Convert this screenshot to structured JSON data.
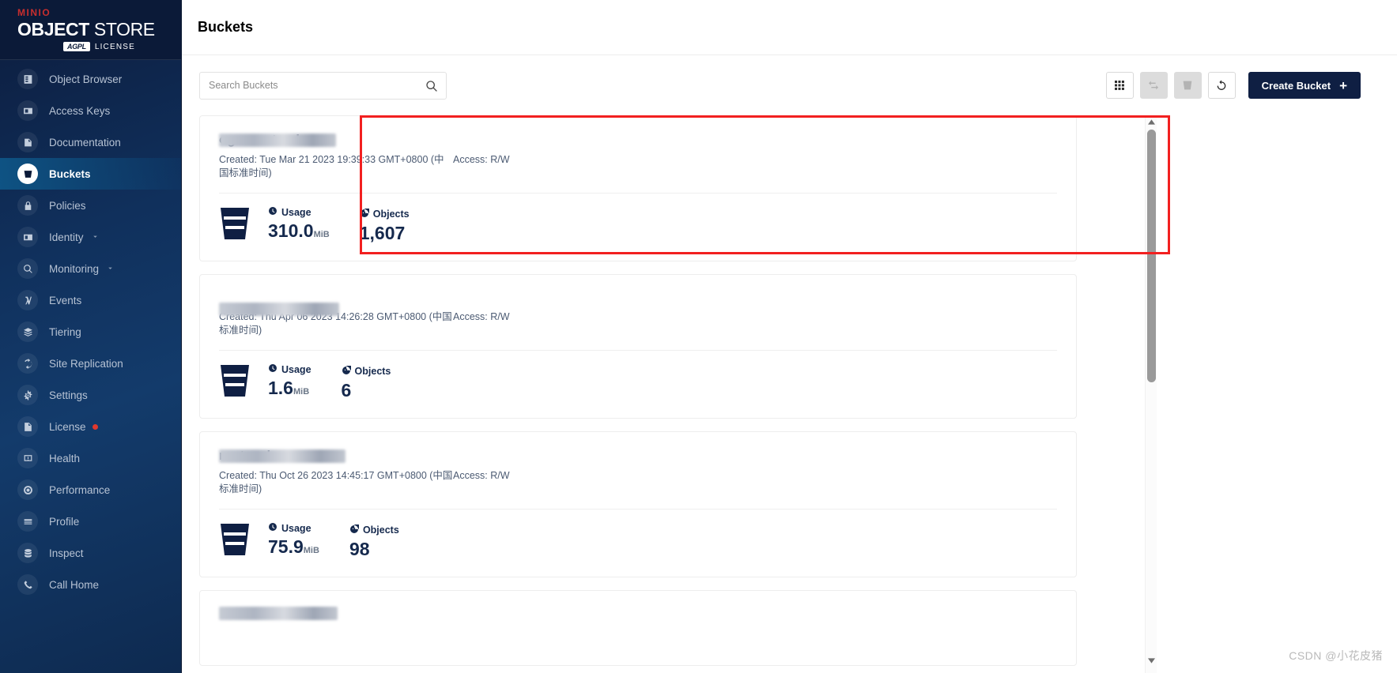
{
  "brand": {
    "minio": "MINIO",
    "object": "OBJECT",
    "store": "STORE",
    "badge": "AGPL",
    "license": "LICENSE"
  },
  "sidebar": {
    "items": [
      {
        "label": "Object Browser",
        "icon": "object-browser-icon",
        "active": false,
        "chevron": false,
        "dot": false
      },
      {
        "label": "Access Keys",
        "icon": "access-keys-icon",
        "active": false,
        "chevron": false,
        "dot": false
      },
      {
        "label": "Documentation",
        "icon": "documentation-icon",
        "active": false,
        "chevron": false,
        "dot": false
      },
      {
        "label": "Buckets",
        "icon": "bucket-icon",
        "active": true,
        "chevron": false,
        "dot": false
      },
      {
        "label": "Policies",
        "icon": "lock-icon",
        "active": false,
        "chevron": false,
        "dot": false
      },
      {
        "label": "Identity",
        "icon": "identity-card-icon",
        "active": false,
        "chevron": true,
        "dot": false
      },
      {
        "label": "Monitoring",
        "icon": "magnifier-icon",
        "active": false,
        "chevron": true,
        "dot": false
      },
      {
        "label": "Events",
        "icon": "lambda-icon",
        "active": false,
        "chevron": false,
        "dot": false
      },
      {
        "label": "Tiering",
        "icon": "layers-icon",
        "active": false,
        "chevron": false,
        "dot": false
      },
      {
        "label": "Site Replication",
        "icon": "replication-icon",
        "active": false,
        "chevron": false,
        "dot": false
      },
      {
        "label": "Settings",
        "icon": "gear-icon",
        "active": false,
        "chevron": false,
        "dot": false
      },
      {
        "label": "License",
        "icon": "license-icon",
        "active": false,
        "chevron": false,
        "dot": true
      },
      {
        "label": "Health",
        "icon": "health-icon",
        "active": false,
        "chevron": false,
        "dot": false
      },
      {
        "label": "Performance",
        "icon": "performance-icon",
        "active": false,
        "chevron": false,
        "dot": false
      },
      {
        "label": "Profile",
        "icon": "profile-icon",
        "active": false,
        "chevron": false,
        "dot": false
      },
      {
        "label": "Inspect",
        "icon": "inspect-icon",
        "active": false,
        "chevron": false,
        "dot": false
      },
      {
        "label": "Call Home",
        "icon": "phone-icon",
        "active": false,
        "chevron": false,
        "dot": false
      }
    ]
  },
  "header": {
    "title": "Buckets"
  },
  "toolbar": {
    "search_placeholder": "Search Buckets",
    "search_value": "",
    "buttons": [
      {
        "name": "grid-view-button",
        "icon": "grid-icon",
        "disabled": false
      },
      {
        "name": "replication-button",
        "icon": "replication-icon",
        "disabled": true
      },
      {
        "name": "delete-bucket-button",
        "icon": "trash-bucket-icon",
        "disabled": true
      },
      {
        "name": "refresh-button",
        "icon": "refresh-icon",
        "disabled": false
      }
    ],
    "create_label": "Create Bucket",
    "create_plus": "+"
  },
  "labels": {
    "created_prefix": "Created: ",
    "access_prefix": "Access: ",
    "usage": "Usage",
    "objects": "Objects"
  },
  "buckets": [
    {
      "name": "oguaranteedev",
      "name_redacted": true,
      "redact_width": 148,
      "created": "Tue Mar 21 2023 19:39:33 GMT+0800 (中国标准时间)",
      "access": "R/W",
      "usage_value": "310.0",
      "usage_unit": "MiB",
      "objects": "1,607"
    },
    {
      "name": "",
      "name_redacted": true,
      "redact_width": 152,
      "created": "Thu Apr 06 2023 14:26:28 GMT+0800 (中国标准时间)",
      "access": "R/W",
      "usage_value": "1.6",
      "usage_unit": "MiB",
      "objects": "6"
    },
    {
      "name": "rentasahsv",
      "name_redacted": true,
      "redact_width": 160,
      "created": "Thu Oct 26 2023 14:45:17 GMT+0800 (中国标准时间)",
      "access": "R/W",
      "usage_value": "75.9",
      "usage_unit": "MiB",
      "objects": "98"
    }
  ],
  "partial_bucket": {
    "name_redacted": true,
    "redact_width": 150
  },
  "annotation": {
    "color": "#f22020"
  },
  "watermark": "CSDN @小花皮猪"
}
